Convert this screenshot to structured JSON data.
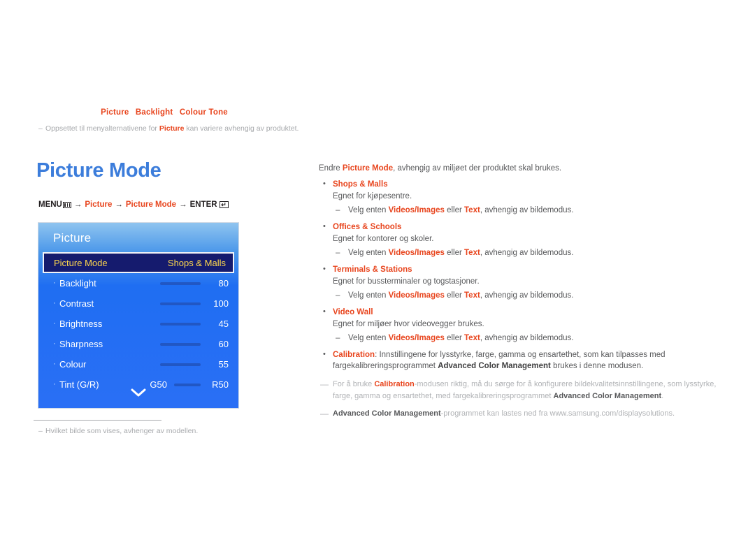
{
  "breadcrumb": {
    "items": [
      "Picture",
      "Backlight",
      "Colour Tone"
    ]
  },
  "top_note": {
    "dash": "–",
    "before": "Oppsettet til menyalternativene for ",
    "bold": "Picture",
    "after": " kan variere avhengig av produktet."
  },
  "page_title": "Picture Mode",
  "menu_path": {
    "menu_label": "MENU",
    "menu_icon": "menu-bars-icon",
    "arrow": "→",
    "step1": "Picture",
    "step2": "Picture Mode",
    "enter_label": "ENTER",
    "enter_icon": "enter-return-icon",
    "enter_glyph": "↵"
  },
  "osd": {
    "title": "Picture",
    "selected_row": {
      "label": "Picture Mode",
      "value": "Shops & Malls"
    },
    "rows": [
      {
        "bullet": "·",
        "label": "Backlight",
        "value": "80",
        "type": "slider"
      },
      {
        "bullet": "·",
        "label": "Contrast",
        "value": "100",
        "type": "slider"
      },
      {
        "bullet": "·",
        "label": "Brightness",
        "value": "45",
        "type": "slider"
      },
      {
        "bullet": "·",
        "label": "Sharpness",
        "value": "60",
        "type": "slider"
      },
      {
        "bullet": "·",
        "label": "Colour",
        "value": "55",
        "type": "slider"
      },
      {
        "bullet": "·",
        "label": "Tint (G/R)",
        "left": "G50",
        "right": "R50",
        "type": "dual"
      }
    ],
    "chevron": "chevron-down-icon"
  },
  "foot_note": {
    "dash": "–",
    "text": "Hvilket bilde som vises, avhenger av modellen."
  },
  "content": {
    "intro": {
      "before": "Endre ",
      "bold": "Picture Mode",
      "after": ", avhengig av miljøet der produktet skal brukes."
    },
    "bullets": [
      {
        "dot": "•",
        "head": "Shops & Malls",
        "desc": "Egnet for kjøpesentre.",
        "sub": {
          "dash": "–",
          "before": "Velg enten ",
          "bold1": "Videos/Images",
          "middle": " eller ",
          "bold2": "Text",
          "after": ", avhengig av bildemodus."
        }
      },
      {
        "dot": "•",
        "head": "Offices & Schools",
        "desc": "Egnet for kontorer og skoler.",
        "sub": {
          "dash": "–",
          "before": "Velg enten ",
          "bold1": "Videos/Images",
          "middle": " eller ",
          "bold2": "Text",
          "after": ", avhengig av bildemodus."
        }
      },
      {
        "dot": "•",
        "head": "Terminals & Stations",
        "desc": "Egnet for bussterminaler og togstasjoner.",
        "sub": {
          "dash": "–",
          "before": "Velg enten ",
          "bold1": "Videos/Images",
          "middle": " eller ",
          "bold2": "Text",
          "after": ", avhengig av bildemodus."
        }
      },
      {
        "dot": "•",
        "head": "Video Wall",
        "desc": "Egnet for miljøer hvor videovegger brukes.",
        "sub": {
          "dash": "–",
          "before": "Velg enten ",
          "bold1": "Videos/Images",
          "middle": " eller ",
          "bold2": "Text",
          "after": ", avhengig av bildemodus."
        }
      }
    ],
    "calibration": {
      "dot": "•",
      "head": "Calibration",
      "text1": ": Innstillingene for lysstyrke, farge, gamma og ensartethet, som kan tilpasses med fargekalibreringsprogrammet ",
      "bold": "Advanced Color Management",
      "text2": " brukes i denne modusen."
    },
    "notes": [
      {
        "dash": "—",
        "part1": "For å bruke ",
        "red": "Calibration",
        "part2": "-modusen riktig, må du sørge for å konfigurere bildekvalitetsinnstillingene, som lysstyrke, farge, gamma og ensartethet, med fargekalibreringsprogrammet ",
        "dark": "Advanced Color Management",
        "part3": "."
      },
      {
        "dash": "—",
        "part1": "",
        "dark_lead": "Advanced Color Management",
        "part2": "-programmet kan lastes ned fra www.samsung.com/displaysolutions.",
        "part3": ""
      }
    ]
  }
}
